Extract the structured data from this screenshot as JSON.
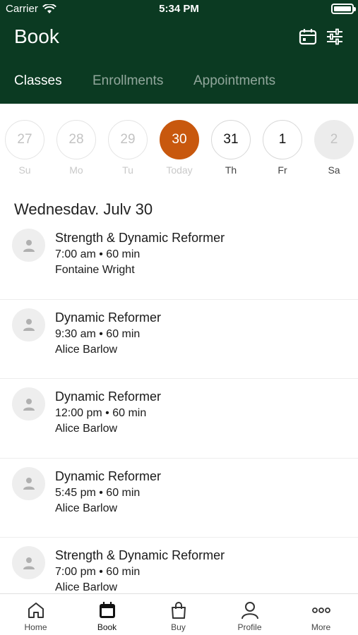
{
  "status_bar": {
    "carrier": "Carrier",
    "time": "5:34 PM"
  },
  "header": {
    "title": "Book",
    "tabs": [
      {
        "label": "Classes",
        "active": true
      },
      {
        "label": "Enrollments",
        "active": false
      },
      {
        "label": "Appointments",
        "active": false
      }
    ],
    "icons": [
      "calendar-icon",
      "filter-sliders-icon"
    ]
  },
  "dates": [
    {
      "num": "27",
      "label": "Su",
      "state": "past"
    },
    {
      "num": "28",
      "label": "Mo",
      "state": "past"
    },
    {
      "num": "29",
      "label": "Tu",
      "state": "past"
    },
    {
      "num": "30",
      "label": "Today",
      "state": "today"
    },
    {
      "num": "31",
      "label": "Th",
      "state": "future"
    },
    {
      "num": "1",
      "label": "Fr",
      "state": "future"
    },
    {
      "num": "2",
      "label": "Sa",
      "state": "faded"
    }
  ],
  "list_heading": "Wednesdav. Julv 30",
  "classes": [
    {
      "name": "Strength & Dynamic Reformer",
      "time": "7:00 am • 60 min",
      "instructor": "Fontaine Wright"
    },
    {
      "name": "Dynamic Reformer",
      "time": "9:30 am • 60 min",
      "instructor": "Alice Barlow"
    },
    {
      "name": "Dynamic Reformer",
      "time": "12:00 pm • 60 min",
      "instructor": "Alice Barlow"
    },
    {
      "name": "Dynamic Reformer",
      "time": "5:45 pm • 60 min",
      "instructor": "Alice Barlow"
    },
    {
      "name": "Strength & Dynamic Reformer",
      "time": "7:00 pm • 60 min",
      "instructor": "Alice Barlow"
    }
  ],
  "tab_bar": [
    {
      "label": "Home",
      "icon": "home-icon",
      "active": false
    },
    {
      "label": "Book",
      "icon": "calendar-icon",
      "active": true
    },
    {
      "label": "Buy",
      "icon": "shopping-bag-icon",
      "active": false
    },
    {
      "label": "Profile",
      "icon": "person-icon",
      "active": false
    },
    {
      "label": "More",
      "icon": "more-dots-icon",
      "active": false
    }
  ],
  "colors": {
    "header_bg": "#0b3a22",
    "accent": "#c8580e"
  }
}
